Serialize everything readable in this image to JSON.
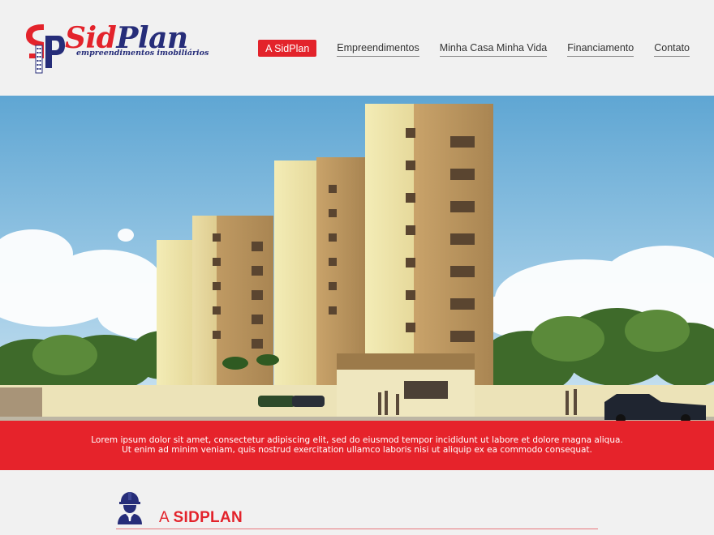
{
  "brand": {
    "name_part1": "Sid",
    "name_part2": "Plan",
    "tagline": "empreendimentos imobiliários",
    "colors": {
      "red": "#e3232b",
      "navy": "#262d79"
    }
  },
  "nav": {
    "items": [
      {
        "label": "A SidPlan",
        "active": true
      },
      {
        "label": "Empreendimentos",
        "active": false
      },
      {
        "label": "Minha Casa Minha Vida",
        "active": false
      },
      {
        "label": "Financiamento",
        "active": false
      },
      {
        "label": "Contato",
        "active": false
      }
    ]
  },
  "hero": {
    "image": "residential-buildings-render"
  },
  "band": {
    "line1": "Lorem ipsum dolor sit amet, consectetur adipiscing elit, sed do eiusmod tempor incididunt ut labore et dolore magna aliqua.",
    "line2": "Ut enim ad minim veniam, quis nostrud exercitation ullamco laboris nisi ut aliquip ex ea commodo consequat."
  },
  "section": {
    "icon": "engineer-helmet-icon",
    "title_prefix": "A ",
    "title_bold": "SIDPLAN"
  }
}
